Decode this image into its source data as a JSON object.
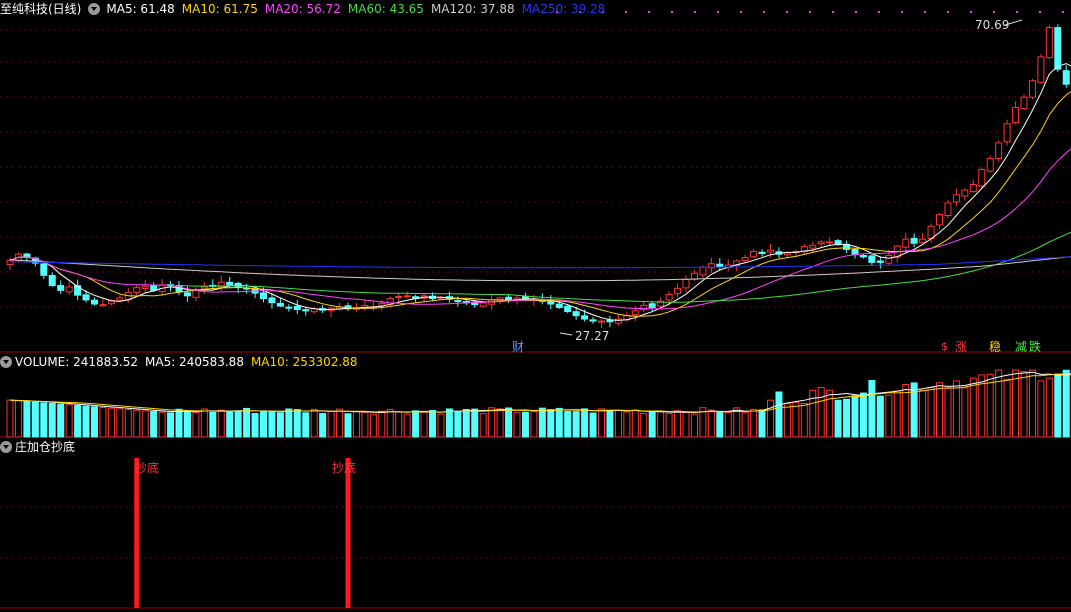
{
  "header": {
    "title": "至纯科技(日线)",
    "ma_labels": [
      {
        "text": "MA5: 61.48",
        "color": "#ffffff"
      },
      {
        "text": "MA10: 61.75",
        "color": "#ffd700"
      },
      {
        "text": "MA20: 56.72",
        "color": "#ff44ff"
      },
      {
        "text": "MA60: 43.65",
        "color": "#44dd44"
      },
      {
        "text": "MA120: 37.88",
        "color": "#cccccc"
      },
      {
        "text": "MA250: 39.28",
        "color": "#2233ff"
      }
    ]
  },
  "price_panel": {
    "high_label": "70.69",
    "low_label": "27.27",
    "tag_cai": "财",
    "tag_zhang": "涨",
    "tag_wen": "稳",
    "tag_jian": "减",
    "tag_die": "跌"
  },
  "volume_panel": {
    "labels": [
      {
        "text": "VOLUME: 241883.52",
        "color": "#ffffff"
      },
      {
        "text": "MA5: 240583.88",
        "color": "#ffffff"
      },
      {
        "text": "MA10: 253302.88",
        "color": "#ffd700"
      }
    ]
  },
  "indicator_panel": {
    "title": "庄加仓抄底",
    "signals": [
      {
        "label": "抄底"
      },
      {
        "label": "抄底"
      }
    ]
  },
  "colors": {
    "up": "#ff3333",
    "down": "#54ffff",
    "grid": "#7a0000",
    "signal": "#ff1a1a"
  },
  "chart_data": {
    "type": "candlestick",
    "price_ylim": [
      26,
      72
    ],
    "closes": [
      36.5,
      37.4,
      37.0,
      36.1,
      34.3,
      32.8,
      32.1,
      32.6,
      31.4,
      30.7,
      30.1,
      30.0,
      30.6,
      31.0,
      31.8,
      32.5,
      32.7,
      32.1,
      32.9,
      32.8,
      31.9,
      31.3,
      32.1,
      32.6,
      32.8,
      33.3,
      32.9,
      32.6,
      32.3,
      31.7,
      30.9,
      30.3,
      29.8,
      29.5,
      29.3,
      29.1,
      29.4,
      29.2,
      29.5,
      29.7,
      29.4,
      29.6,
      29.9,
      29.7,
      30.2,
      30.9,
      31.2,
      31.3,
      30.9,
      31.3,
      30.9,
      31.1,
      30.8,
      30.6,
      30.4,
      30.0,
      30.3,
      30.7,
      31.0,
      30.7,
      31.0,
      30.8,
      30.8,
      30.5,
      30.1,
      29.6,
      29.0,
      28.4,
      27.9,
      27.6,
      27.6,
      27.5,
      27.9,
      28.4,
      29.1,
      29.9,
      29.6,
      30.5,
      31.5,
      32.4,
      33.7,
      34.6,
      35.5,
      36.0,
      35.6,
      35.8,
      36.4,
      36.9,
      37.8,
      37.5,
      38.0,
      37.4,
      37.6,
      37.8,
      38.5,
      38.7,
      39.2,
      39.2,
      38.8,
      38.1,
      37.4,
      37.0,
      36.2,
      36.2,
      37.2,
      38.6,
      39.6,
      39.0,
      39.6,
      41.5,
      43.2,
      44.9,
      46.1,
      46.8,
      47.6,
      49.8,
      51.4,
      53.7,
      56.5,
      58.9,
      60.4,
      62.8,
      66.3,
      70.6,
      64.5,
      62.3,
      60.0,
      62.6
    ],
    "ma_series": [
      {
        "name": "MA5",
        "color": "#ffffff",
        "value": 61.48
      },
      {
        "name": "MA10",
        "color": "#ffd700",
        "value": 61.75
      },
      {
        "name": "MA20",
        "color": "#ff44ff",
        "value": 56.72
      },
      {
        "name": "MA60",
        "color": "#44dd44",
        "value": 43.65
      },
      {
        "name": "MA120",
        "color": "#cccccc",
        "value": 37.88
      },
      {
        "name": "MA250",
        "color": "#2233ff",
        "value": 39.28
      }
    ],
    "price_high": 70.69,
    "price_low": 27.27,
    "volume_last": 241883.52,
    "volume_ma5": 240583.88,
    "volume_ma10": 253302.88,
    "signal_indices": [
      15,
      40
    ]
  }
}
